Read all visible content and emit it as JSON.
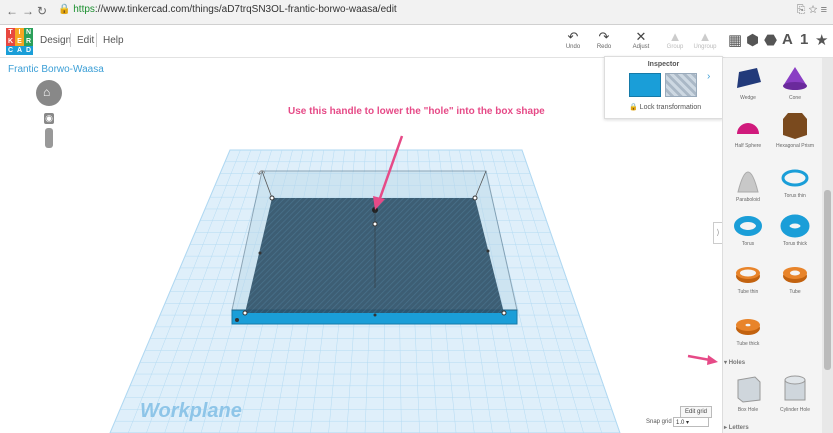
{
  "browser": {
    "url_secure": "https",
    "url_rest": "://www.tinkercad.com/things/aD7trqSN3OL-frantic-borwo-waasa/edit"
  },
  "logo": {
    "letters": [
      "T",
      "I",
      "N",
      "K",
      "E",
      "R",
      "C",
      "A",
      "D"
    ],
    "colors": [
      "#e8473f",
      "#f6a623",
      "#2ba05a",
      "#e8473f",
      "#f6a623",
      "#2ba05a",
      "#1a9ed8",
      "#1a9ed8",
      "#1a9ed8"
    ]
  },
  "menu": {
    "design": "Design",
    "edit": "Edit",
    "help": "Help"
  },
  "tools": {
    "undo": "Undo",
    "redo": "Redo",
    "adjust": "Adjust",
    "group": "Group",
    "ungroup": "Ungroup"
  },
  "project": {
    "title": "Frantic Borwo-Waasa"
  },
  "annotation": {
    "text": "Use this handle to lower the \"hole\" into the box shape",
    "color": "#e64a87"
  },
  "workplane": {
    "label": "Workplane"
  },
  "inspector": {
    "title": "Inspector",
    "lock_label": "Lock transformation"
  },
  "grid": {
    "edit_label": "Edit grid",
    "snap_label": "Snap grid",
    "snap_value": "1.0"
  },
  "shapes": [
    {
      "label": "Wedge"
    },
    {
      "label": "Cone"
    },
    {
      "label": "Half Sphere"
    },
    {
      "label": "Hexagonal Prism"
    },
    {
      "label": "Paraboloid"
    },
    {
      "label": "Torus thin"
    },
    {
      "label": "Torus"
    },
    {
      "label": "Torus thick"
    },
    {
      "label": "Tube thin"
    },
    {
      "label": "Tube"
    },
    {
      "label": "Tube thick"
    }
  ],
  "sections": {
    "holes": "Holes",
    "letters": "Letters"
  },
  "holes": [
    {
      "label": "Box Hole"
    },
    {
      "label": "Cylinder Hole"
    }
  ],
  "colors": {
    "accent": "#1a9ed8",
    "workplane_grid": "#a9d4f0",
    "annotation": "#e64a87"
  }
}
